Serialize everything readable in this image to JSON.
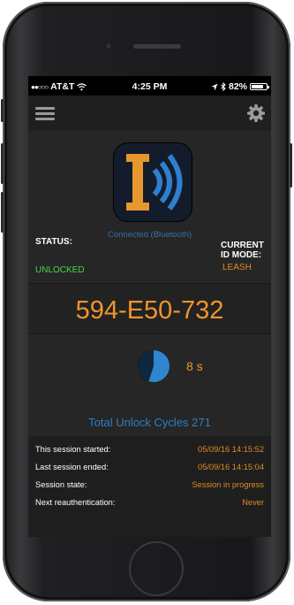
{
  "status_bar": {
    "carrier": "AT&T",
    "time": "4:25 PM",
    "battery": "82%",
    "battery_level": 0.82
  },
  "device": {
    "connection": "Connected (Bluetooth)",
    "status_label": "STATUS:",
    "status_value": "UNLOCKED",
    "mode_label_line1": "CURRENT",
    "mode_label_line2": "ID MODE:",
    "mode_value": "LEASH",
    "code": "594-E50-732",
    "timer": "8 s",
    "timer_fraction": 0.55,
    "total_cycles": "Total Unlock Cycles 271"
  },
  "session": [
    {
      "label": "This session started:",
      "value": "05/09/16  14:15:52"
    },
    {
      "label": "Last session ended:",
      "value": "05/09/16  14:15:04"
    },
    {
      "label": "Session state:",
      "value": "Session in progress"
    },
    {
      "label": "Next reauthentication:",
      "value": "Never"
    }
  ],
  "colors": {
    "accent_orange": "#f0952c",
    "unlocked_green": "#48d848",
    "link_blue": "#2e7fc0"
  }
}
